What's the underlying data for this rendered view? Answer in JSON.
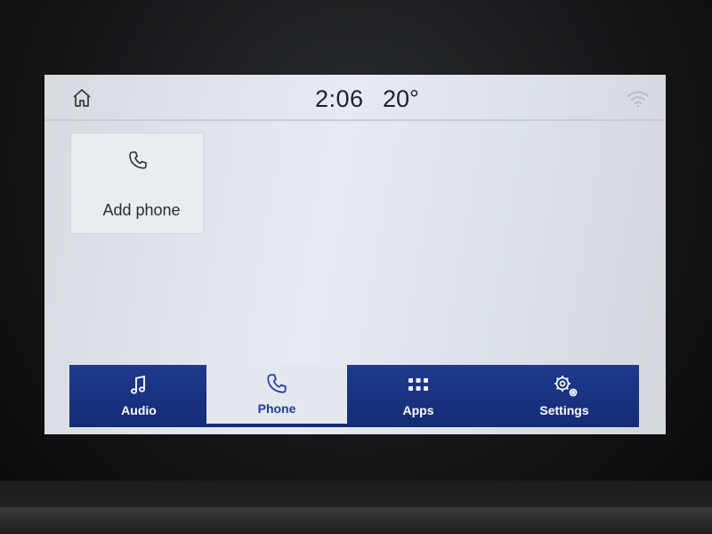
{
  "status": {
    "time": "2:06",
    "temperature": "20°",
    "home_icon": "home-icon",
    "signal_icon": "wifi-icon"
  },
  "main": {
    "tiles": [
      {
        "label": "Add phone",
        "icon": "phone-icon"
      }
    ]
  },
  "nav": {
    "items": [
      {
        "label": "Audio",
        "icon": "music-note-icon",
        "active": false
      },
      {
        "label": "Phone",
        "icon": "phone-icon",
        "active": true
      },
      {
        "label": "Apps",
        "icon": "grid-icon",
        "active": false
      },
      {
        "label": "Settings",
        "icon": "gear-icon",
        "active": false
      }
    ]
  },
  "colors": {
    "nav_background": "#1a3282",
    "active_accent": "#1d3f9e",
    "screen_background": "#e2e6ed"
  }
}
